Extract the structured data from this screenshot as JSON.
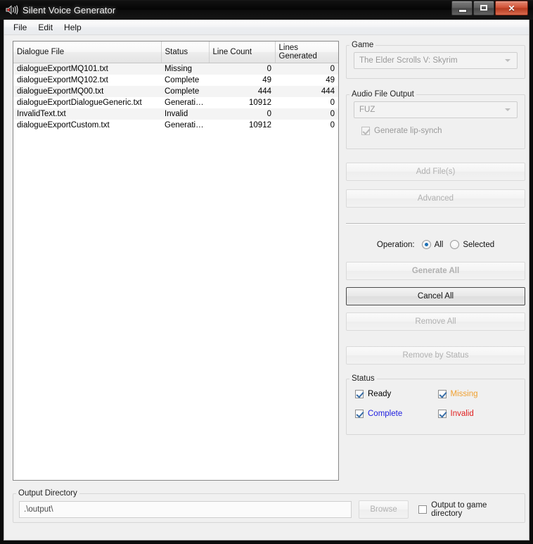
{
  "window": {
    "title": "Silent Voice Generator",
    "icon": "speaker-muted-icon",
    "minimize_label": "─",
    "maximize_label": "□",
    "close_label": "✕"
  },
  "menubar": {
    "items": [
      {
        "label": "File"
      },
      {
        "label": "Edit"
      },
      {
        "label": "Help"
      }
    ]
  },
  "table": {
    "columns": [
      "Dialogue File",
      "Status",
      "Line Count",
      "Lines Generated"
    ],
    "rows": [
      {
        "file": "dialogueExportMQ101.txt",
        "status": "Missing",
        "status_kind": "missing",
        "line_count": "0",
        "lines_generated": "0"
      },
      {
        "file": "dialogueExportMQ102.txt",
        "status": "Complete",
        "status_kind": "complete",
        "line_count": "49",
        "lines_generated": "49"
      },
      {
        "file": "dialogueExportMQ00.txt",
        "status": "Complete",
        "status_kind": "complete",
        "line_count": "444",
        "lines_generated": "444"
      },
      {
        "file": "dialogueExportDialogueGeneric.txt",
        "status": "Generating...",
        "status_kind": "generating",
        "line_count": "10912",
        "lines_generated": "0"
      },
      {
        "file": "InvalidText.txt",
        "status": "Invalid",
        "status_kind": "invalid",
        "line_count": "0",
        "lines_generated": "0"
      },
      {
        "file": "dialogueExportCustom.txt",
        "status": "Generating...",
        "status_kind": "generating",
        "line_count": "10912",
        "lines_generated": "0"
      }
    ]
  },
  "game_group": {
    "legend": "Game",
    "selected": "The Elder Scrolls V: Skyrim",
    "enabled": false
  },
  "audio_group": {
    "legend": "Audio File Output",
    "selected": "FUZ",
    "lipsync": {
      "label": "Generate lip-synch",
      "checked": true,
      "enabled": false
    }
  },
  "actions": {
    "add_files": {
      "label": "Add File(s)",
      "enabled": false
    },
    "advanced": {
      "label": "Advanced",
      "enabled": false
    },
    "generate_all": {
      "label": "Generate All",
      "enabled": false
    },
    "cancel_all": {
      "label": "Cancel All",
      "enabled": true
    },
    "remove_all": {
      "label": "Remove All",
      "enabled": false
    },
    "remove_by_status": {
      "label": "Remove by Status",
      "enabled": false
    }
  },
  "operation": {
    "label": "Operation:",
    "options": [
      {
        "label": "All",
        "selected": true
      },
      {
        "label": "Selected",
        "selected": false
      }
    ]
  },
  "status_filter": {
    "legend": "Status",
    "items": [
      {
        "label": "Ready",
        "checked": true,
        "kind": "ready"
      },
      {
        "label": "Missing",
        "checked": true,
        "kind": "missing"
      },
      {
        "label": "Complete",
        "checked": true,
        "kind": "complete"
      },
      {
        "label": "Invalid",
        "checked": true,
        "kind": "invalid"
      }
    ]
  },
  "output": {
    "legend": "Output Directory",
    "path_value": ".\\output\\",
    "browse_label": "Browse",
    "browse_enabled": false,
    "game_dir_checkbox": {
      "label": "Output to game directory",
      "checked": false
    }
  },
  "colors": {
    "missing": "#f0a030",
    "complete": "#2020e0",
    "generating": "#11a11a",
    "invalid": "#e02020",
    "ready": "#000000"
  }
}
